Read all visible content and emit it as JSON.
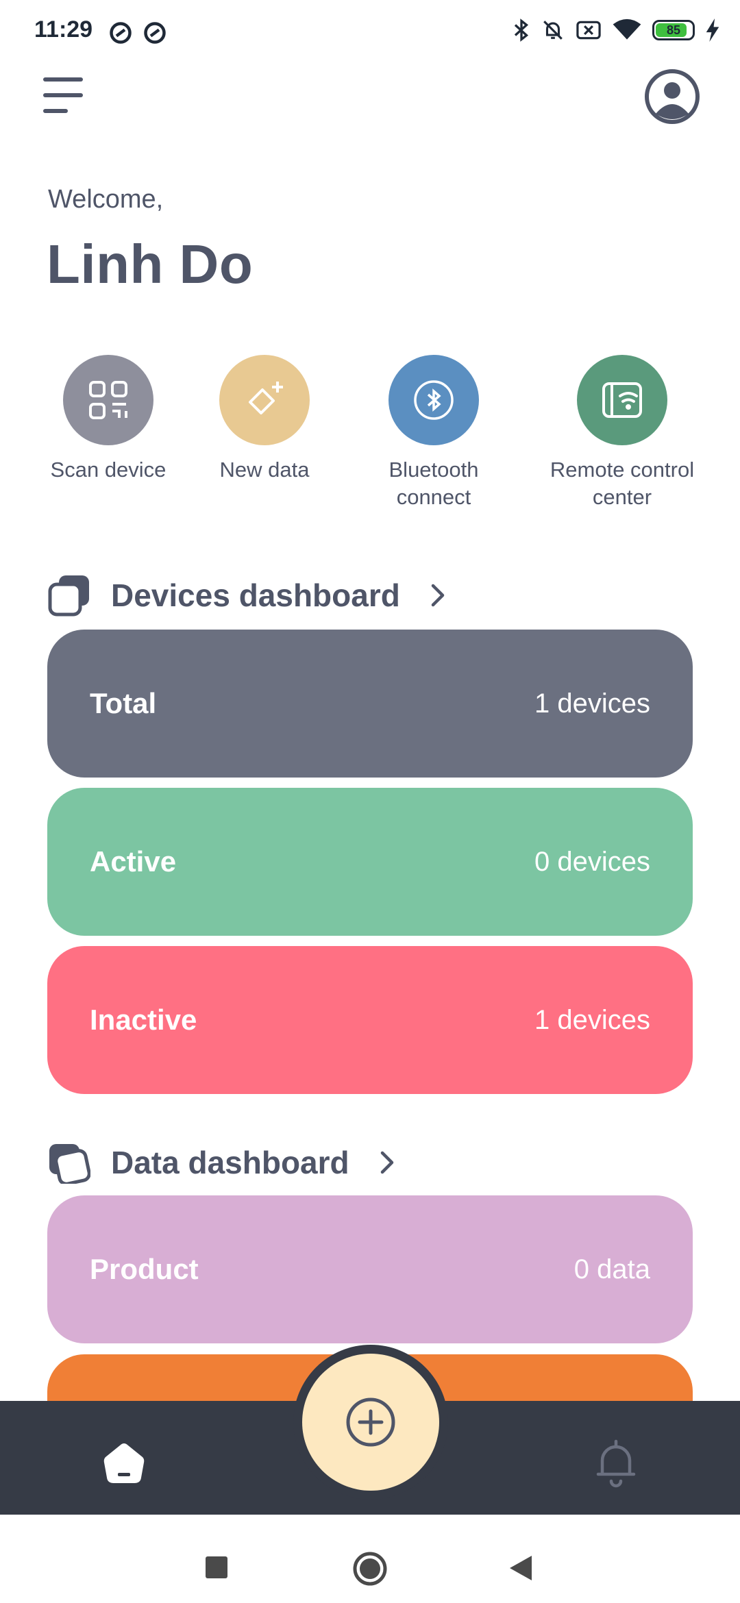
{
  "status_bar": {
    "time": "11:29",
    "battery_level": "85",
    "icons": [
      "at-sign-icon",
      "at-sign-icon",
      "bluetooth-icon",
      "bell-off-icon",
      "sim-off-icon",
      "wifi-icon",
      "battery-icon",
      "charging-icon"
    ]
  },
  "header": {
    "menu_icon": "menu-icon",
    "profile_icon": "profile-icon",
    "welcome": "Welcome,",
    "user_name": "Linh Do"
  },
  "quick_actions": [
    {
      "label": "Scan device",
      "icon": "qr-scan-icon",
      "color": "#8e8f9c"
    },
    {
      "label": "New data",
      "icon": "new-data-icon",
      "color": "#e8c992"
    },
    {
      "label": "Bluetooth connect",
      "icon": "bluetooth-icon",
      "color": "#5b8fc1"
    },
    {
      "label": "Remote control center",
      "icon": "remote-icon",
      "color": "#5a9a7c"
    }
  ],
  "devices_dashboard": {
    "title": "Devices dashboard",
    "cards": [
      {
        "label": "Total",
        "value": "1 devices",
        "color": "#6b7080"
      },
      {
        "label": "Active",
        "value": "0 devices",
        "color": "#7cc5a2"
      },
      {
        "label": "Inactive",
        "value": "1 devices",
        "color": "#ff7083"
      }
    ]
  },
  "data_dashboard": {
    "title": "Data dashboard",
    "cards": [
      {
        "label": "Product",
        "value": "0 data",
        "color": "#d8aed4"
      },
      {
        "label": "",
        "value": "",
        "color": "#f07f36"
      }
    ]
  },
  "bottom_nav": {
    "home_icon": "home-icon",
    "add_icon": "add-circle-icon",
    "bell_icon": "bell-icon"
  },
  "system_nav": [
    "recents-icon",
    "home-circle-icon",
    "back-icon"
  ]
}
